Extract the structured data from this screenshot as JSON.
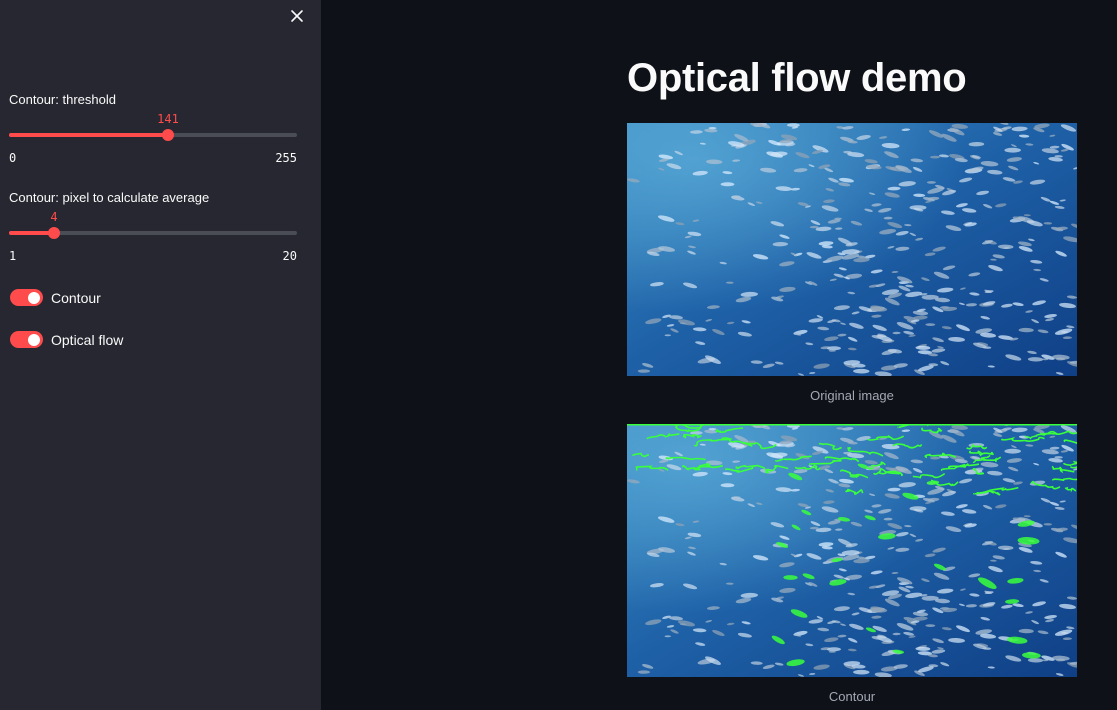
{
  "sidebar": {
    "close_icon": "close-icon",
    "sliders": [
      {
        "label": "Contour: threshold",
        "value": "141",
        "min": "0",
        "max": "255",
        "fraction": 0.553
      },
      {
        "label": "Contour: pixel to calculate average",
        "value": "4",
        "min": "1",
        "max": "20",
        "fraction": 0.158
      }
    ],
    "toggles": [
      {
        "label": "Contour",
        "on": true
      },
      {
        "label": "Optical flow",
        "on": true
      }
    ]
  },
  "main": {
    "title": "Optical flow demo",
    "images": [
      {
        "caption": "Original image",
        "kind": "underwater-fish-school"
      },
      {
        "caption": "Contour",
        "kind": "underwater-fish-school-with-green-contours"
      }
    ]
  },
  "colors": {
    "accent": "#ff4b4b",
    "sidebar_bg": "#262730",
    "main_bg": "#0e1117",
    "contour": "#39ff3c"
  }
}
